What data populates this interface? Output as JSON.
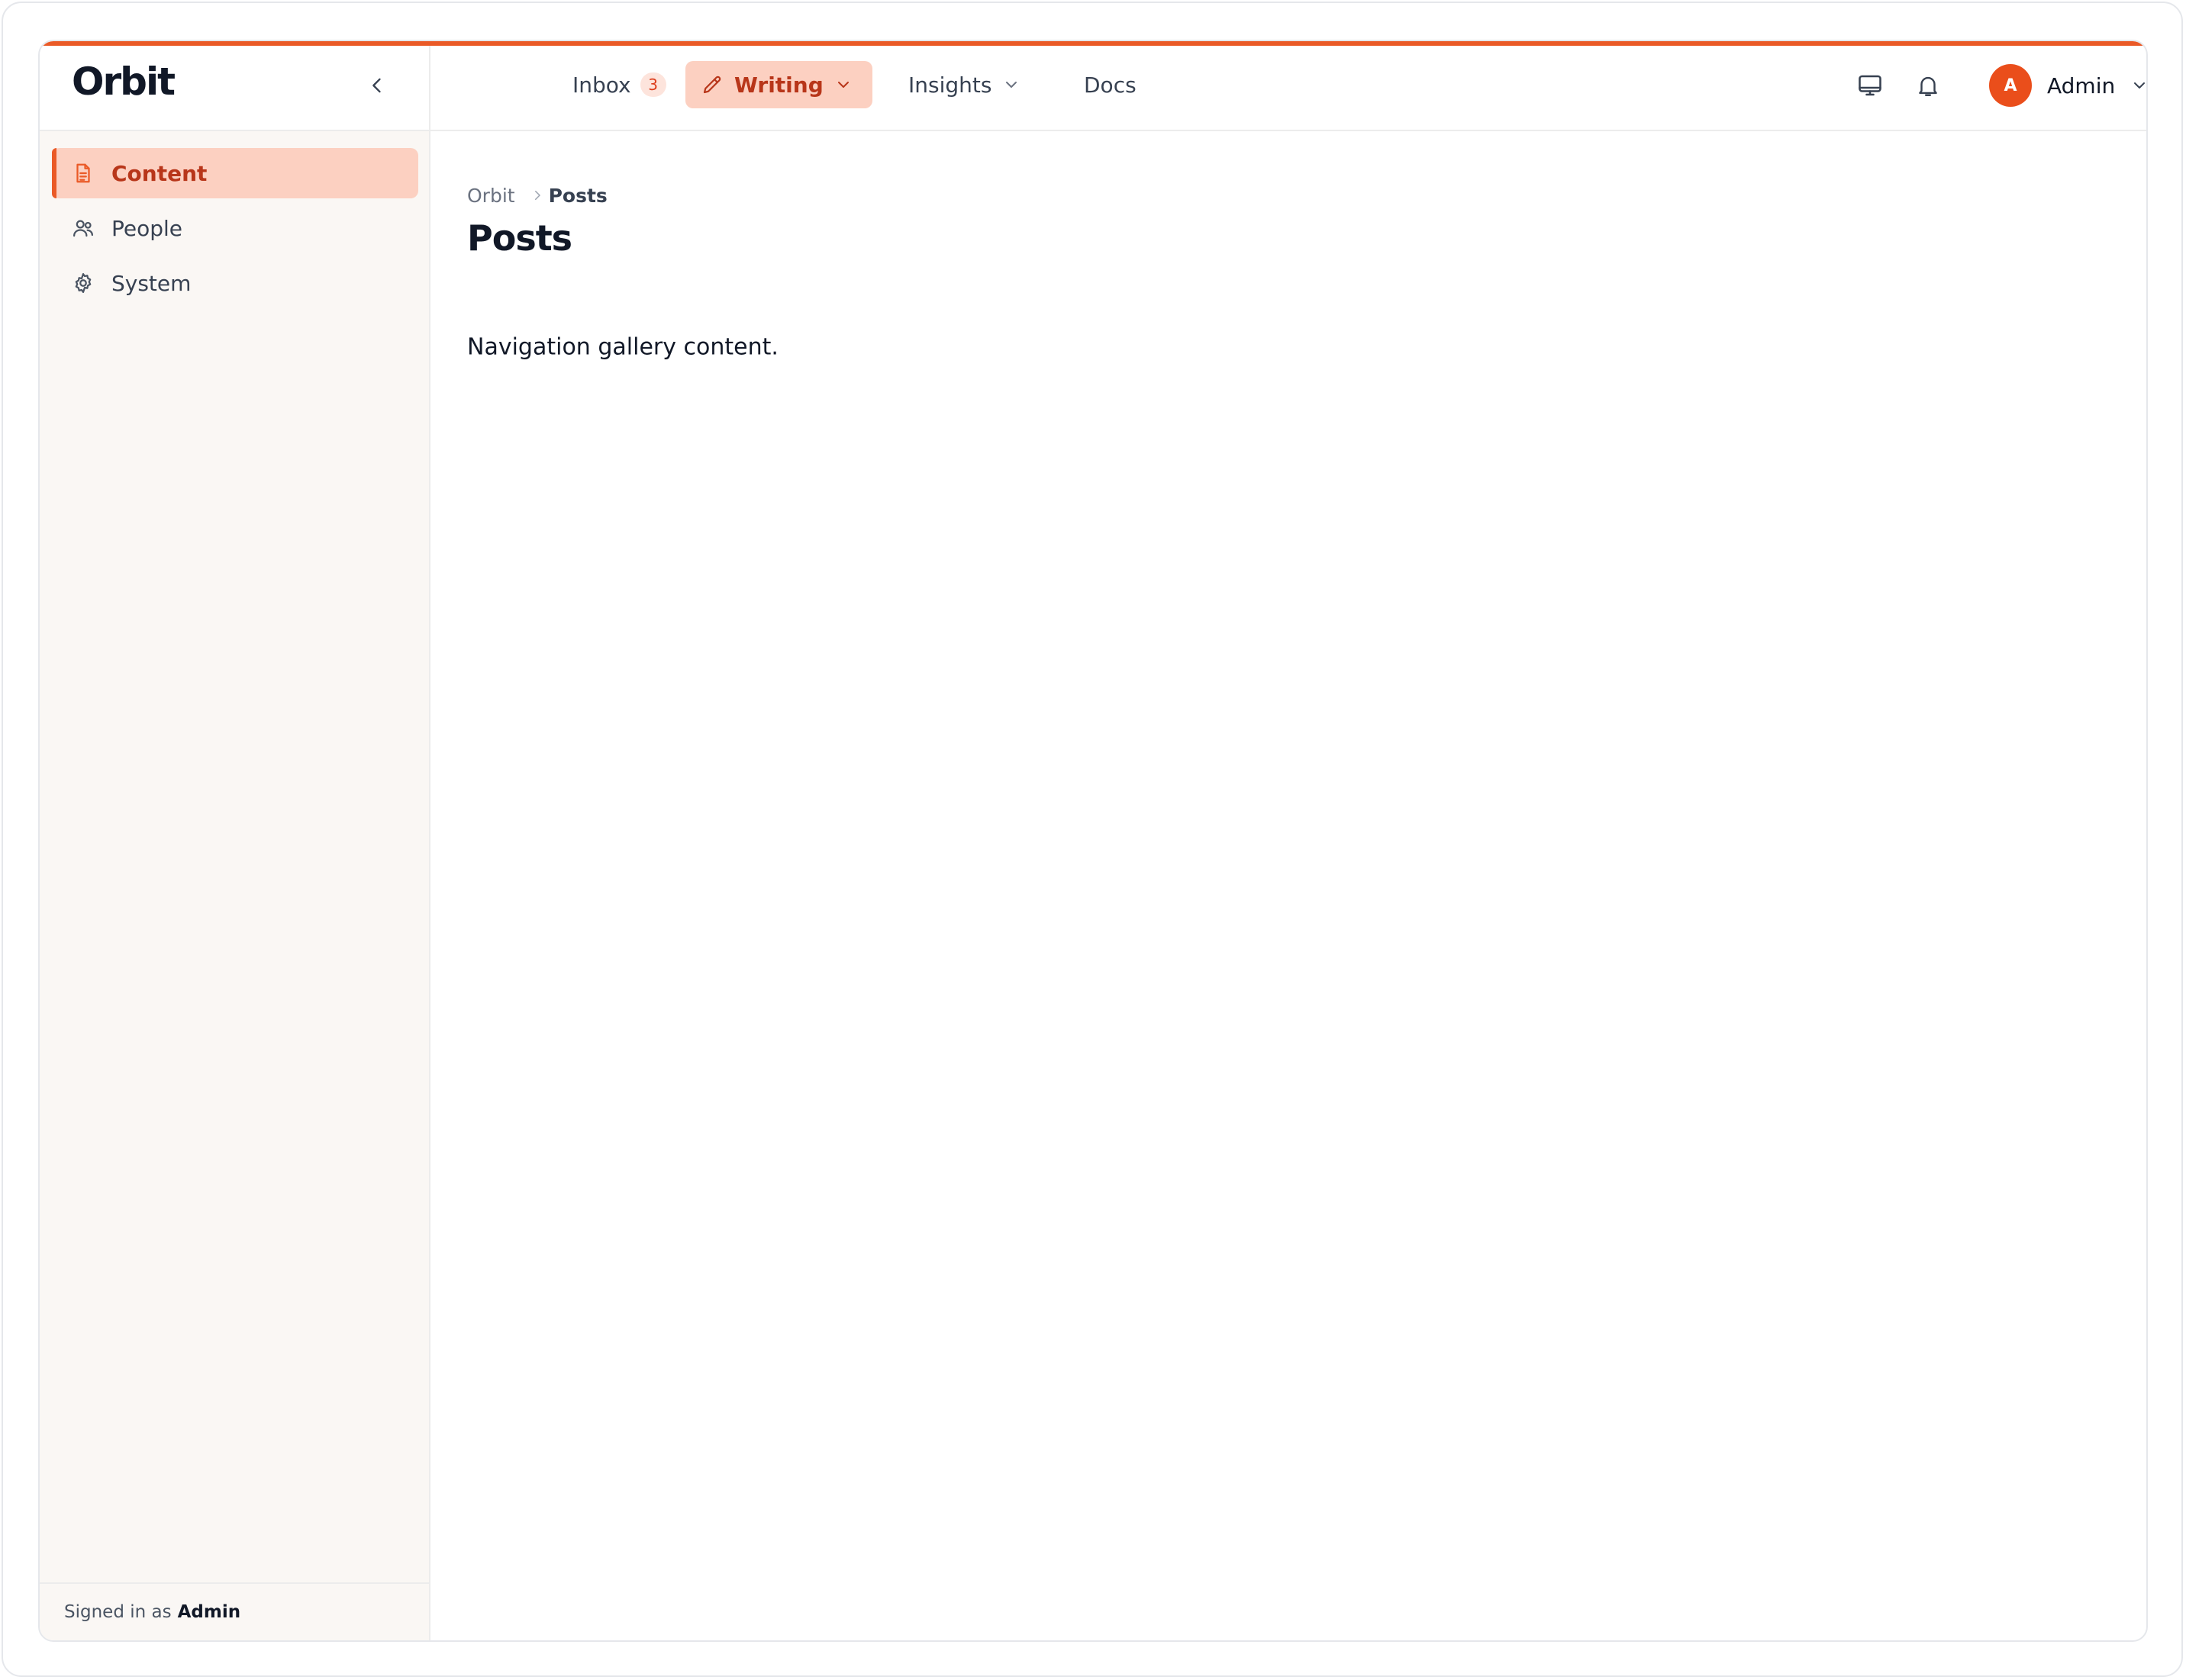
{
  "app": {
    "logo": "Orbit"
  },
  "sidebar": {
    "items": [
      {
        "label": "Content",
        "icon": "document-icon",
        "active": true
      },
      {
        "label": "People",
        "icon": "users-icon",
        "active": false
      },
      {
        "label": "System",
        "icon": "gear-icon",
        "active": false
      }
    ],
    "footer": {
      "prefix": "Signed in as",
      "user": "Admin"
    }
  },
  "header": {
    "tabs": [
      {
        "label": "Inbox",
        "badge": "3"
      },
      {
        "label": "Writing",
        "active": true
      },
      {
        "label": "Insights"
      },
      {
        "label": "Docs"
      }
    ],
    "user": {
      "initial": "A",
      "name": "Admin"
    }
  },
  "breadcrumb": {
    "root": "Orbit",
    "current": "Posts"
  },
  "main": {
    "title": "Posts",
    "body": "Navigation gallery content."
  },
  "colors": {
    "accent": "#ea5a27",
    "accent_soft": "#fcd0c1",
    "accent_text": "#b8361a",
    "sidebar_bg": "#faf7f4"
  }
}
